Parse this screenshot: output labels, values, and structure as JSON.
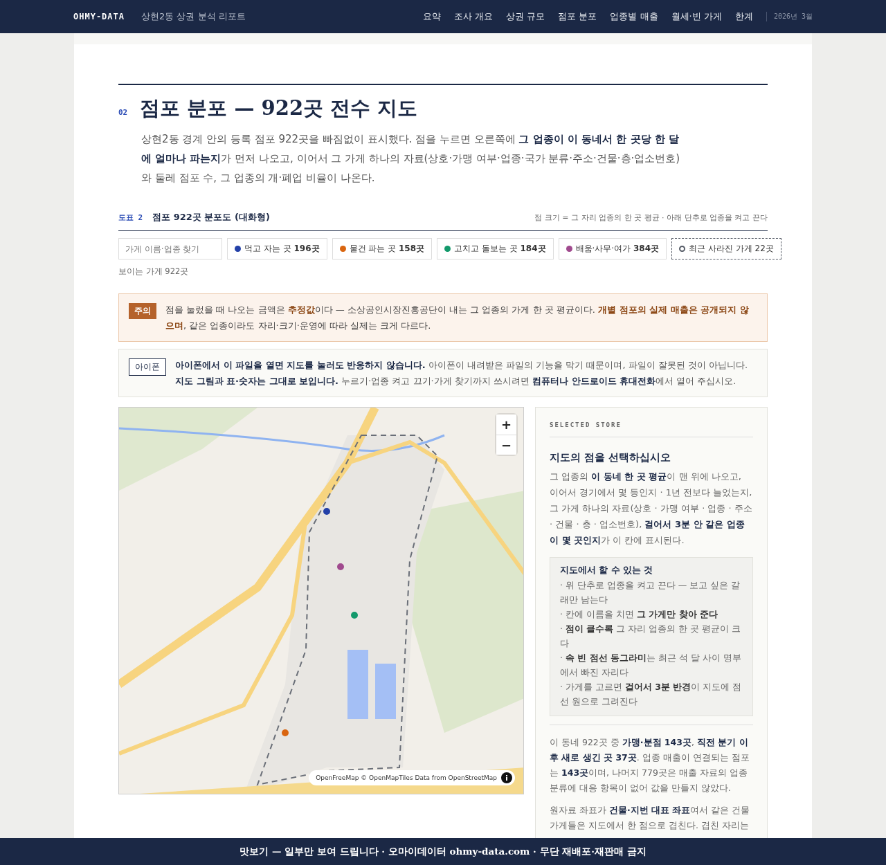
{
  "header": {
    "brand": "OHMY-DATA",
    "subtitle": "상현2동 상권 분석 리포트",
    "nav": [
      "요약",
      "조사 개요",
      "상권 규모",
      "점포 분포",
      "업종별 매출",
      "월세·빈 가게",
      "한계"
    ],
    "date": "2026년 3월"
  },
  "section": {
    "number": "02",
    "title": "점포 분포 — 922곳 전수 지도",
    "intro": "상현2동 경계 안의 등록 점포 922곳을 빠짐없이 표시했다. 점을 누르면 오른쪽에 **그 업종이 이 동네서 한 곳당 한 달에 얼마나 파는지**가 먼저 나오고, 이어서 그 가게 하나의 자료(상호·가맹 여부·업종·국가 분류·주소·건물·층·업소번호)와 둘레 점포 수, 그 업종의 개·폐업 비율이 나온다."
  },
  "figure": {
    "label": "도표 2",
    "title": "점포 922곳 분포도 (대화형)",
    "note": "점 크기 = 그 자리 업종의 한 곳 평균 · 아래 단추로 업종을 켜고 끈다",
    "search": {
      "placeholder": "가게 이름·업종 찾기"
    },
    "filters": [
      {
        "kind": "dot",
        "color": "#2340a8",
        "label": "먹고 자는 곳 **196곳**"
      },
      {
        "kind": "dot",
        "color": "#d9650f",
        "label": "물건 파는 곳 **158곳**"
      },
      {
        "kind": "dot",
        "color": "#12996b",
        "label": "고치고 돌보는 곳 **184곳**"
      },
      {
        "kind": "dot",
        "color": "#a04a8e",
        "label": "배움·사무·여가 **384곳**"
      },
      {
        "kind": "ring",
        "color": "#555b66",
        "label": "최근 사라진 가게 22곳"
      }
    ],
    "visible_count": "보이는 가게 922곳"
  },
  "notices": [
    {
      "kind": "warning",
      "badge": "주의",
      "text": "점을 눌렀을 때 나오는 금액은 **추정값**이다 — 소상공인시장진흥공단이 내는 그 업종의 가게 한 곳 평균이다. **개별 점포의 실제 매출은 공개되지 않으며**, 같은 업종이라도 자리·크기·운영에 따라 실제는 크게 다르다."
    },
    {
      "kind": "info",
      "badge": "아이폰",
      "text": "**아이폰에서 이 파일을 열면 지도를 눌러도 반응하지 않습니다.** 아이폰이 내려받은 파일의 기능을 막기 때문이며, 파일이 잘못된 것이 아닙니다. **지도 그림과 표·숫자는 그대로 보입니다.** 누르기·업종 켜고 끄기·가게 찾기까지 쓰시려면 **컴퓨터나 안드로이드 휴대전화**에서 열어 주십시오."
    }
  ],
  "map": {
    "zoom_in": "+",
    "zoom_out": "−",
    "attribution": "OpenFreeMap © OpenMapTiles Data from OpenStreetMap"
  },
  "panel": {
    "eyebrow": "SELECTED STORE",
    "heading": "지도의 점을 선택하십시오",
    "body": "그 업종의 **이 동네 한 곳 평균**이 맨 위에 나오고, 이어서 경기에서 몇 등인지 · 1년 전보다 늘었는지, 그 가게 하나의 자료(상호 · 가맹 여부 · 업종 · 주소 · 건물 · 층 · 업소번호), **걸어서 3분 안 같은 업종이 몇 곳인지**가 이 칸에 표시된다.",
    "tips_title": "지도에서 할 수 있는 것",
    "tips": [
      "· 위 단추로 업종을 켜고 끈다 — 보고 싶은 갈래만 남는다",
      "· 칸에 이름을 치면 **그 가게만 찾아 준다**",
      "· **점이 클수록** 그 자리 업종의 한 곳 평균이 크다",
      "· **속 빈 점선 동그라미**는 최근 석 달 사이 명부에서 빠진 자리다",
      "· 가게를 고르면 **걸어서 3분 반경**이 지도에 점선 원으로 그려진다"
    ],
    "notes": [
      "이 동네 922곳 중 **가맹·분점 143곳**, **직전 분기 이후 새로 생긴 곳 37곳**. 업종 매출이 연결되는 점포는 **143곳**이며, 나머지 779곳은 매출 자료의 업종 분류에 대응 항목이 없어 값을 만들지 않았다.",
      "원자료 좌표가 **건물·지번 대표 좌표**여서 같은 건물 가게들은 지도에서 한 점으로 겹친다. 겹친 자리는"
    ]
  },
  "footer": "맛보기 — 일부만 보여 드립니다 · 오마이데이터 ohmy-data.com · 무단 재배포·재판매 금지"
}
